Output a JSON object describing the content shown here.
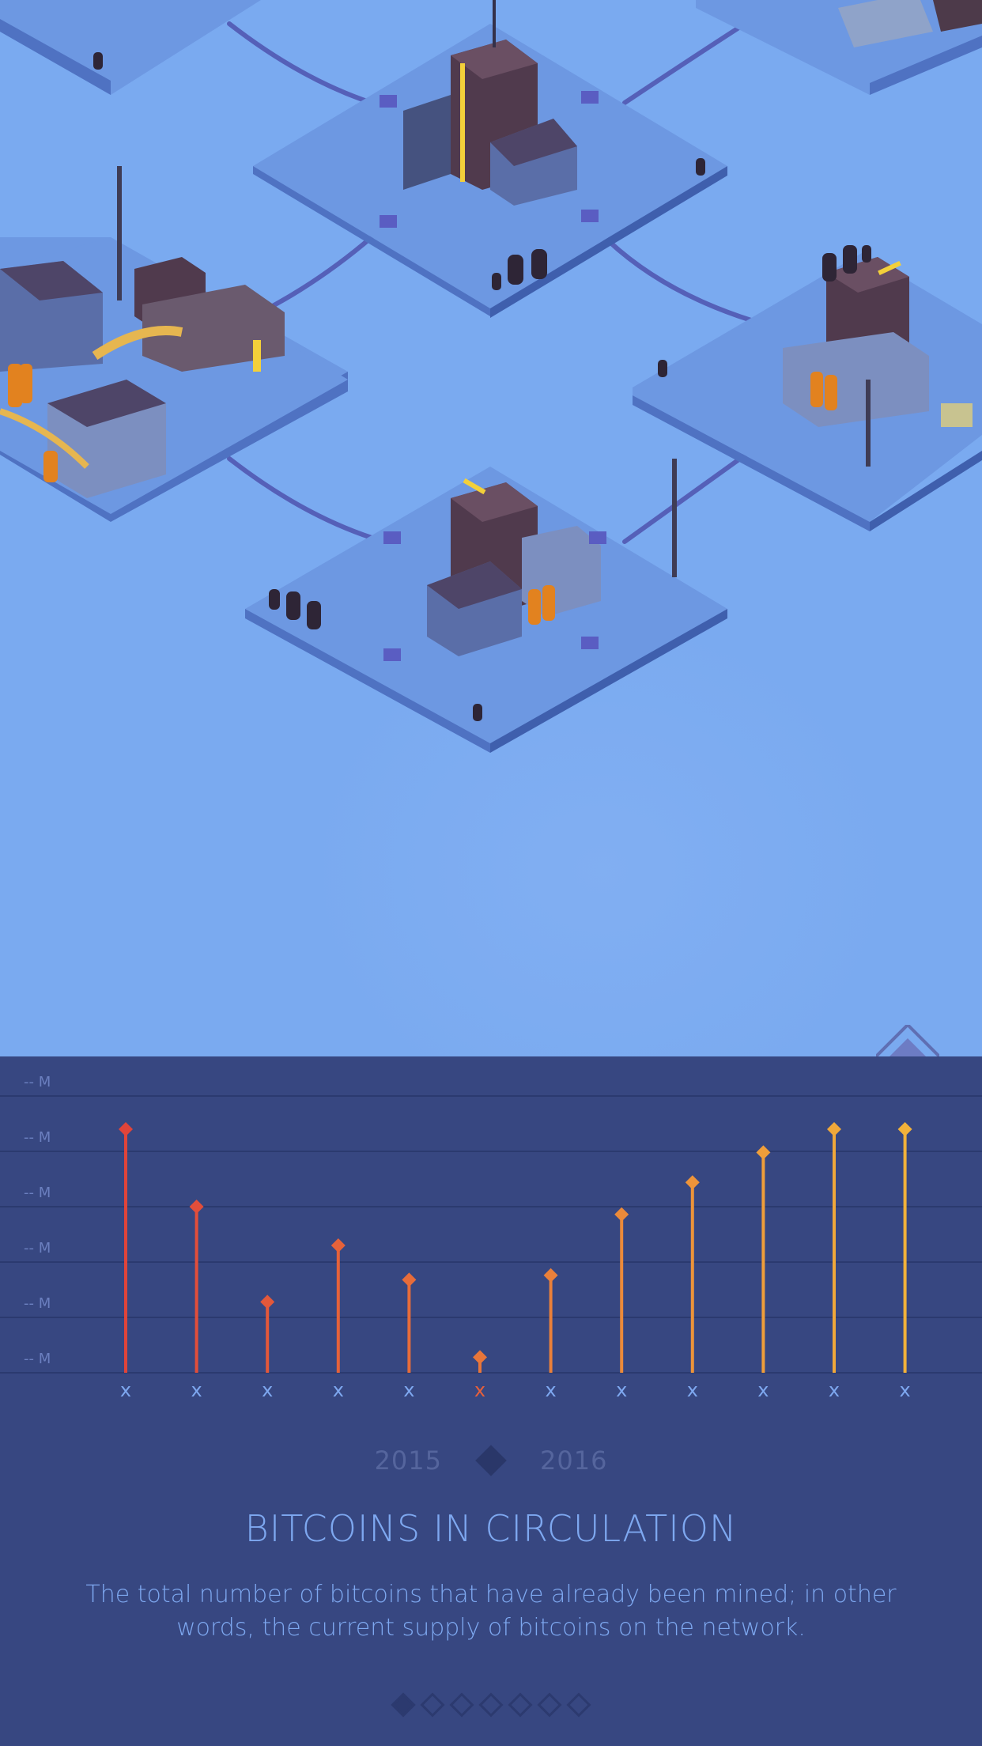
{
  "colors": {
    "sky": "#7aaaf0",
    "panel": "#374781",
    "grid": "#2b3a6f",
    "accent_red": "#e0443a",
    "accent_yellow": "#f2b23a",
    "label_blue": "#7ea8f0"
  },
  "nav": {
    "corner_button_icon": "diamond-icon",
    "year_prev": "2015",
    "year_next": "2016",
    "year_toggle_icon": "diamond-icon"
  },
  "chart_data": {
    "type": "bar",
    "title": "BITCOINS IN CIRCULATION",
    "description": "The total number of bitcoins that have already been mined; in other words, the current supply of bitcoins on the network.",
    "y_tick_labels": [
      "-- M",
      "-- M",
      "-- M",
      "-- M",
      "-- M",
      "-- M"
    ],
    "ylim": [
      0,
      5
    ],
    "categories": [
      "x",
      "x",
      "x",
      "x",
      "x",
      "x",
      "x",
      "x",
      "x",
      "x",
      "x",
      "x"
    ],
    "values": [
      4.4,
      3.0,
      1.28,
      2.3,
      1.68,
      0.28,
      1.76,
      2.86,
      3.44,
      3.98,
      4.4,
      4.4
    ],
    "highlighted_index": 5,
    "grid": true
  },
  "pager": {
    "count": 7,
    "active_index": 0,
    "icon": "diamond-icon"
  }
}
